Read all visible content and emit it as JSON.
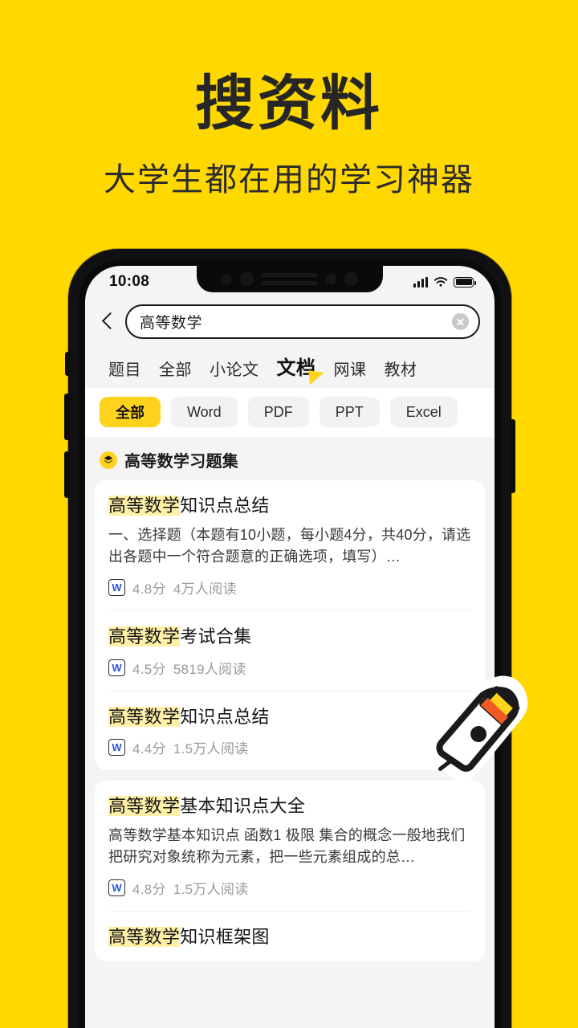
{
  "promo": {
    "title": "搜资料",
    "subtitle": "大学生都在用的学习神器",
    "background_color": "#FFD800",
    "title_color": "#262626"
  },
  "phone": {
    "status_bar": {
      "time": "10:08",
      "signal_icon": "signal-bars-icon",
      "wifi_icon": "wifi-icon",
      "battery_icon": "battery-full-icon"
    },
    "notch_icons": [
      "camera-dot-icon",
      "sensor-dot-icon",
      "speaker-bar-icon",
      "sensor-dot-icon",
      "camera-dot-icon"
    ]
  },
  "search": {
    "back_icon": "back-chevron-icon",
    "value": "高等数学",
    "placeholder": "搜索资料",
    "clear_icon": "clear-circle-icon"
  },
  "tabs": [
    {
      "label": "题目",
      "active": false
    },
    {
      "label": "全部",
      "active": false
    },
    {
      "label": "小论文",
      "active": false
    },
    {
      "label": "文档",
      "active": true
    },
    {
      "label": "网课",
      "active": false
    },
    {
      "label": "教材",
      "active": false
    }
  ],
  "filters": [
    {
      "label": "全部",
      "active": true
    },
    {
      "label": "Word",
      "active": false
    },
    {
      "label": "PDF",
      "active": false
    },
    {
      "label": "PPT",
      "active": false
    },
    {
      "label": "Excel",
      "active": false
    }
  ],
  "section": {
    "icon": "layers-stack-icon",
    "title": "高等数学习题集"
  },
  "results": [
    {
      "card": 1,
      "items": [
        {
          "title_highlight": "高等数学",
          "title_rest": "知识点总结",
          "description": "一、选择题（本题有10小题，每小题4分，共40分，请选出各题中一个符合题意的正确选项，填写）…",
          "file_icon": "word-doc-icon",
          "rating": "4.8分",
          "reads": "4万人阅读"
        },
        {
          "title_highlight": "高等数学",
          "title_rest": "考试合集",
          "description": "",
          "file_icon": "word-doc-icon",
          "rating": "4.5分",
          "reads": "5819人阅读"
        },
        {
          "title_highlight": "高等数学",
          "title_rest": "知识点总结",
          "description": "",
          "file_icon": "word-doc-icon",
          "rating": "4.4分",
          "reads": "1.5万人阅读"
        }
      ]
    },
    {
      "card": 2,
      "items": [
        {
          "title_highlight": "高等数学",
          "title_rest": "基本知识点大全",
          "description": "高等数学基本知识点 函数1 极限 集合的概念一般地我们把研究对象统称为元素，把一些元素组成的总…",
          "file_icon": "word-doc-icon",
          "rating": "4.8分",
          "reads": "1.5万人阅读"
        },
        {
          "title_highlight": "高等数学",
          "title_rest": "知识框架图",
          "description": "",
          "file_icon": "word-doc-icon",
          "rating": "",
          "reads": ""
        }
      ]
    }
  ],
  "sticker": {
    "icon": "pen-nib-sticker-icon",
    "accent_yellow": "#FFD21E",
    "accent_orange": "#F15A24"
  },
  "colors": {
    "brand_yellow": "#FFD800",
    "chip_yellow": "#FFD21E",
    "highlight_yellow": "#FFF0A8",
    "screen_bg": "#F4F4F4",
    "card_bg": "#FFFFFF",
    "meta_gray": "#9A9A9A",
    "word_blue": "#2B57D6"
  }
}
